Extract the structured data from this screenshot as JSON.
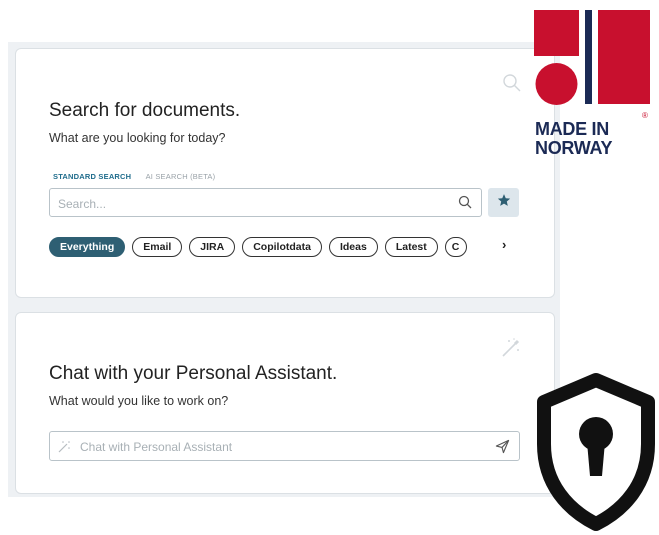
{
  "search_card": {
    "title": "Search for documents.",
    "subtitle": "What are you looking for today?",
    "tabs": [
      {
        "label": "STANDARD SEARCH",
        "active": true
      },
      {
        "label": "AI SEARCH (BETA)",
        "active": false
      }
    ],
    "search_placeholder": "Search...",
    "filters": [
      {
        "label": "Everything",
        "active": true
      },
      {
        "label": "Email",
        "active": false
      },
      {
        "label": "JIRA",
        "active": false
      },
      {
        "label": "Copilotdata",
        "active": false
      },
      {
        "label": "Ideas",
        "active": false
      },
      {
        "label": "Latest",
        "active": false
      },
      {
        "label": "C",
        "active": false
      }
    ],
    "next_label": "›"
  },
  "chat_card": {
    "title": "Chat with your Personal Assistant.",
    "subtitle": "What would you like to work on?",
    "chat_placeholder": "Chat with Personal Assistant"
  },
  "badge": {
    "line1": "MADE IN",
    "line2": "NORWAY",
    "registered": "®"
  },
  "colors": {
    "accent": "#2e5f73",
    "norway_red": "#c8102e",
    "norway_blue": "#1b2a55"
  }
}
